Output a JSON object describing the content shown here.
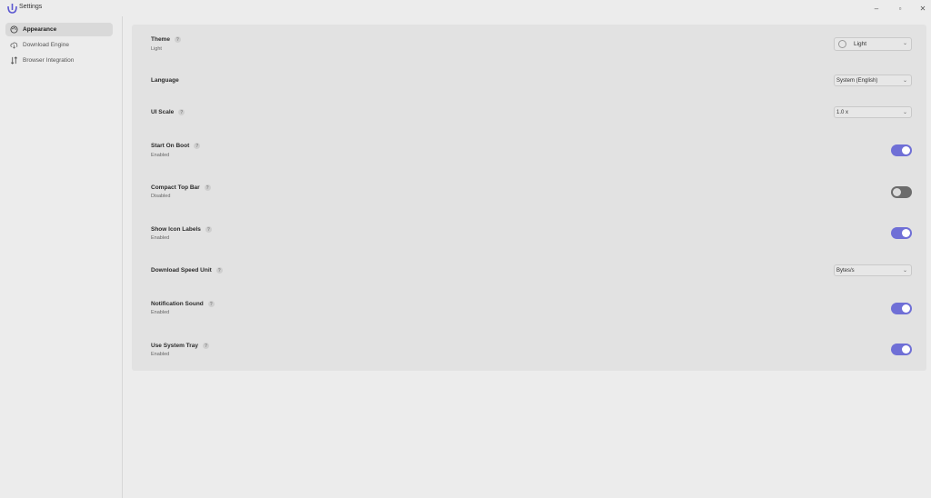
{
  "window": {
    "title": "Settings",
    "controls": {
      "minimize": "–",
      "maximize": "▫",
      "close": "✕"
    }
  },
  "sidebar": {
    "items": [
      {
        "label": "Appearance",
        "icon": "palette-icon",
        "active": true
      },
      {
        "label": "Download Engine",
        "icon": "cloud-download-icon",
        "active": false
      },
      {
        "label": "Browser Integration",
        "icon": "transfer-arrows-icon",
        "active": false
      }
    ]
  },
  "settings": {
    "theme": {
      "title": "Theme",
      "subtitle": "Light",
      "value": "Light"
    },
    "language": {
      "title": "Language",
      "value": "System (English)"
    },
    "ui_scale": {
      "title": "UI Scale",
      "value": "1.0 x"
    },
    "start_on_boot": {
      "title": "Start On Boot",
      "subtitle": "Enabled",
      "on": true
    },
    "compact_top_bar": {
      "title": "Compact Top Bar",
      "subtitle": "Disabled",
      "on": false
    },
    "show_icon_labels": {
      "title": "Show Icon Labels",
      "subtitle": "Enabled",
      "on": true
    },
    "download_speed_unit": {
      "title": "Download Speed Unit",
      "value": "Bytes/s"
    },
    "notification_sound": {
      "title": "Notification Sound",
      "subtitle": "Enabled",
      "on": true
    },
    "use_system_tray": {
      "title": "Use System Tray",
      "subtitle": "Enabled",
      "on": true
    }
  },
  "help_glyph": "?",
  "chevron_glyph": "⌄",
  "colors": {
    "toggle_on": "#6f6fd6",
    "toggle_off": "#6c6c6c",
    "accent_logo": "#5b57d1"
  }
}
